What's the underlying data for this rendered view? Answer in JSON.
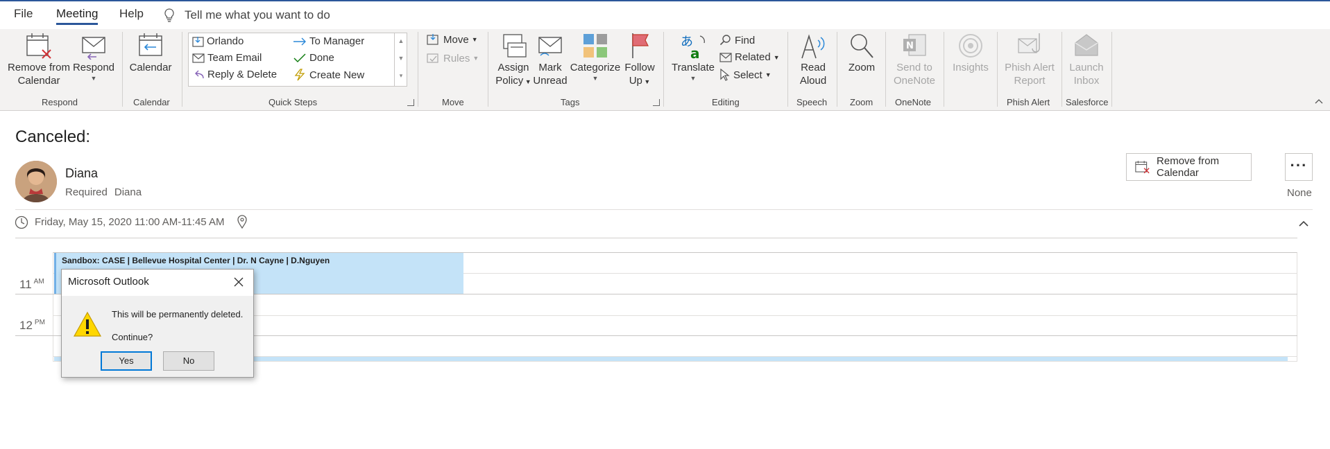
{
  "menubar": {
    "tabs": [
      "File",
      "Meeting",
      "Help"
    ],
    "active_tab": "Meeting",
    "tell_me": "Tell me what you want to do"
  },
  "ribbon": {
    "respond": {
      "remove_from_calendar": [
        "Remove from",
        "Calendar"
      ],
      "respond": "Respond",
      "label": "Respond"
    },
    "calendar": {
      "calendar": "Calendar",
      "label": "Calendar"
    },
    "quick_steps": {
      "items": [
        "Orlando",
        "To Manager",
        "Team Email",
        "Done",
        "Reply & Delete",
        "Create New"
      ],
      "label": "Quick Steps"
    },
    "move": {
      "move": "Move",
      "rules": "Rules",
      "label": "Move"
    },
    "tags": {
      "assign_policy": [
        "Assign",
        "Policy"
      ],
      "mark_unread": [
        "Mark",
        "Unread"
      ],
      "categorize": "Categorize",
      "follow_up": [
        "Follow",
        "Up"
      ],
      "label": "Tags"
    },
    "editing": {
      "translate": "Translate",
      "find": "Find",
      "related": "Related",
      "select": "Select",
      "label": "Editing"
    },
    "speech": {
      "read_aloud": [
        "Read",
        "Aloud"
      ],
      "label": "Speech"
    },
    "zoom": {
      "zoom": "Zoom",
      "label": "Zoom"
    },
    "onenote": {
      "send": [
        "Send to",
        "OneNote"
      ],
      "label": "OneNote"
    },
    "insights": {
      "insights": "Insights"
    },
    "phish_alert": {
      "report": [
        "Phish Alert",
        "Report"
      ],
      "label": "Phish Alert"
    },
    "salesforce": {
      "launch": [
        "Launch",
        "Inbox"
      ],
      "label": "Salesforce"
    }
  },
  "meeting": {
    "title": "Canceled:",
    "sender": "Diana",
    "required_label": "Required",
    "required_name": "Diana",
    "remove_button": "Remove from Calendar",
    "more": "···",
    "response": "None",
    "datetime": "Friday, May 15, 2020 11:00 AM-11:45 AM"
  },
  "calendar_preview": {
    "hours": [
      {
        "num": "11",
        "ampm": "AM"
      },
      {
        "num": "12",
        "ampm": "PM"
      }
    ],
    "event_text": "Sandbox: CASE | Bellevue Hospital Center | Dr. N Cayne |  D.Nguyen"
  },
  "dialog": {
    "title": "Microsoft Outlook",
    "message": "This will be permanently deleted.",
    "question": "Continue?",
    "yes": "Yes",
    "no": "No"
  },
  "colors": {
    "accent": "#2b579a",
    "event_fill": "#c4e3f8",
    "event_border": "#71afe5",
    "dialog_focus": "#0078d7"
  }
}
